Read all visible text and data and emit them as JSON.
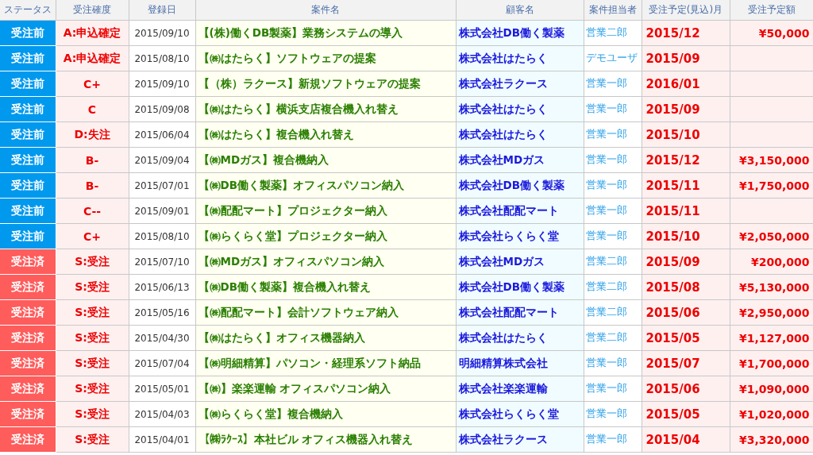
{
  "table": {
    "columns": [
      "ステータス",
      "受注確度",
      "登録日",
      "案件名",
      "顧客名",
      "案件担当者",
      "受注予定(見込)月",
      "受注予定額"
    ],
    "rows": [
      {
        "status": "受注前",
        "kind": "pending",
        "confidence": "A:申込確定",
        "date": "2015/09/10",
        "project": "【(株)働くDB製薬】業務システムの導入",
        "customer": "株式会社DB働く製薬",
        "owner": "営業二郎",
        "month": "2015/12",
        "amount": "¥50,000"
      },
      {
        "status": "受注前",
        "kind": "pending",
        "confidence": "A:申込確定",
        "date": "2015/08/10",
        "project": "【㈱はたらく】ソフトウェアの提案",
        "customer": "株式会社はたらく",
        "owner": "デモユーザ",
        "month": "2015/09"
      },
      {
        "status": "受注前",
        "kind": "pending",
        "confidence": "C+",
        "date": "2015/09/10",
        "project": "【（株）ラクース】新規ソフトウェアの提案",
        "customer": "株式会社ラクース",
        "owner": "営業一郎",
        "month": "2016/01"
      },
      {
        "status": "受注前",
        "kind": "pending",
        "confidence": "C",
        "date": "2015/09/08",
        "project": "【㈱はたらく】横浜支店複合機入れ替え",
        "customer": "株式会社はたらく",
        "owner": "営業一郎",
        "month": "2015/09"
      },
      {
        "status": "受注前",
        "kind": "pending",
        "confidence": "D:失注",
        "date": "2015/06/04",
        "project": "【㈱はたらく】複合機入れ替え",
        "customer": "株式会社はたらく",
        "owner": "営業一郎",
        "month": "2015/10"
      },
      {
        "status": "受注前",
        "kind": "pending",
        "confidence": "B-",
        "date": "2015/09/04",
        "project": "【㈱MDガス】複合機納入",
        "customer": "株式会社MDガス",
        "owner": "営業一郎",
        "month": "2015/12",
        "amount": "¥3,150,000"
      },
      {
        "status": "受注前",
        "kind": "pending",
        "confidence": "B-",
        "date": "2015/07/01",
        "project": "【㈱DB働く製薬】オフィスパソコン納入",
        "customer": "株式会社DB働く製薬",
        "owner": "営業一郎",
        "month": "2015/11",
        "amount": "¥1,750,000"
      },
      {
        "status": "受注前",
        "kind": "pending",
        "confidence": "C--",
        "date": "2015/09/01",
        "project": "【㈱配配マート】プロジェクター納入",
        "customer": "株式会社配配マート",
        "owner": "営業一郎",
        "month": "2015/11"
      },
      {
        "status": "受注前",
        "kind": "pending",
        "confidence": "C+",
        "date": "2015/08/10",
        "project": "【㈱らくらく堂】プロジェクター納入",
        "customer": "株式会社らくらく堂",
        "owner": "営業一郎",
        "month": "2015/10",
        "amount": "¥2,050,000"
      },
      {
        "status": "受注済",
        "kind": "won",
        "confidence": "S:受注",
        "date": "2015/07/10",
        "project": "【㈱MDガス】オフィスパソコン納入",
        "customer": "株式会社MDガス",
        "owner": "営業二郎",
        "month": "2015/09",
        "amount": "¥200,000"
      },
      {
        "status": "受注済",
        "kind": "won",
        "confidence": "S:受注",
        "date": "2015/06/13",
        "project": "【㈱DB働く製薬】複合機入れ替え",
        "customer": "株式会社DB働く製薬",
        "owner": "営業二郎",
        "month": "2015/08",
        "amount": "¥5,130,000"
      },
      {
        "status": "受注済",
        "kind": "won",
        "confidence": "S:受注",
        "date": "2015/05/16",
        "project": "【㈱配配マート】会計ソフトウェア納入",
        "customer": "株式会社配配マート",
        "owner": "営業二郎",
        "month": "2015/06",
        "amount": "¥2,950,000"
      },
      {
        "status": "受注済",
        "kind": "won",
        "confidence": "S:受注",
        "date": "2015/04/30",
        "project": "【㈱はたらく】オフィス機器納入",
        "customer": "株式会社はたらく",
        "owner": "営業二郎",
        "month": "2015/05",
        "amount": "¥1,127,000"
      },
      {
        "status": "受注済",
        "kind": "won",
        "confidence": "S:受注",
        "date": "2015/07/04",
        "project": "【㈱明細精算】パソコン・経理系ソフト納品",
        "customer": "明細精算株式会社",
        "owner": "営業一郎",
        "month": "2015/07",
        "amount": "¥1,700,000"
      },
      {
        "status": "受注済",
        "kind": "won",
        "confidence": "S:受注",
        "date": "2015/05/01",
        "project": "【㈱】楽楽運輸 オフィスパソコン納入",
        "customer": "株式会社楽楽運輸",
        "owner": "営業一郎",
        "month": "2015/06",
        "amount": "¥1,090,000"
      },
      {
        "status": "受注済",
        "kind": "won",
        "confidence": "S:受注",
        "date": "2015/04/03",
        "project": "【㈱らくらく堂】複合機納入",
        "customer": "株式会社らくらく堂",
        "owner": "営業一郎",
        "month": "2015/05",
        "amount": "¥1,020,000"
      },
      {
        "status": "受注済",
        "kind": "won",
        "confidence": "S:受注",
        "date": "2015/04/01",
        "project": "【㈱ﾗｸｰｽ】本社ビル オフィス機器入れ替え",
        "customer": "株式会社ラクース",
        "owner": "営業一郎",
        "month": "2015/04",
        "amount": "¥3,320,000"
      }
    ]
  }
}
